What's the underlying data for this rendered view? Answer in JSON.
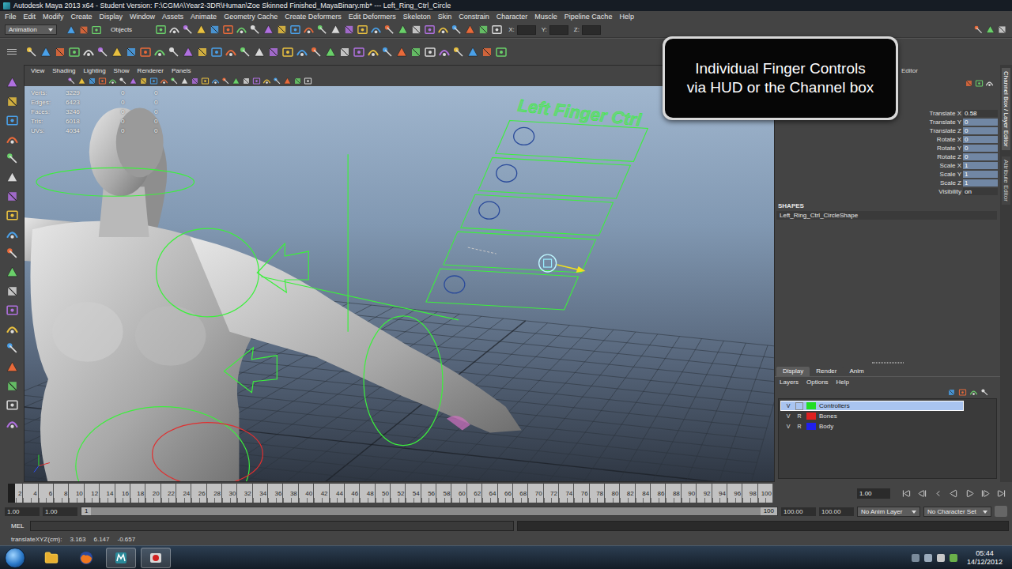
{
  "window": {
    "title": "Autodesk Maya 2013 x64 - Student Version: F:\\CGMA\\Year2-3DR\\Human\\Zoe Skinned Finished_MayaBinary.mb*  ---  Left_Ring_Ctrl_Circle"
  },
  "menu": [
    "File",
    "Edit",
    "Modify",
    "Create",
    "Display",
    "Window",
    "Assets",
    "Animate",
    "Geometry Cache",
    "Create Deformers",
    "Edit Deformers",
    "Skeleton",
    "Skin",
    "Constrain",
    "Character",
    "Muscle",
    "Pipeline Cache",
    "Help"
  ],
  "status_line": {
    "menu_set": "Animation",
    "selection_mask": "Objects",
    "coordinate_fields": [
      "X:",
      "Y:",
      "Z:"
    ]
  },
  "viewport": {
    "menu": [
      "View",
      "Shading",
      "Lighting",
      "Show",
      "Renderer",
      "Panels"
    ],
    "hud": [
      {
        "label": "Verts:",
        "values": [
          "3229",
          "0",
          "0"
        ]
      },
      {
        "label": "Edges:",
        "values": [
          "6423",
          "0",
          "0"
        ]
      },
      {
        "label": "Faces:",
        "values": [
          "3246",
          "0",
          "0"
        ]
      },
      {
        "label": "Tris:",
        "values": [
          "6018",
          "0",
          "0"
        ]
      },
      {
        "label": "UVs:",
        "values": [
          "4034",
          "0",
          "0"
        ]
      }
    ],
    "scene_label": "Left Finger Ctrl",
    "finger_controls": [
      {
        "selected": false
      },
      {
        "selected": false
      },
      {
        "selected": false
      },
      {
        "selected": true
      },
      {
        "selected": false
      }
    ]
  },
  "caption": {
    "lines": [
      "Individual Finger Controls",
      "via HUD or the Channel box"
    ]
  },
  "channel_box": {
    "header": "Editor",
    "channels": [
      {
        "name": "Translate X",
        "value": "0.58",
        "highlighted": false
      },
      {
        "name": "Translate Y",
        "value": "0",
        "highlighted": true
      },
      {
        "name": "Translate Z",
        "value": "0",
        "highlighted": true
      },
      {
        "name": "Rotate X",
        "value": "0",
        "highlighted": true
      },
      {
        "name": "Rotate Y",
        "value": "0",
        "highlighted": true
      },
      {
        "name": "Rotate Z",
        "value": "0",
        "highlighted": true
      },
      {
        "name": "Scale X",
        "value": "1",
        "highlighted": true
      },
      {
        "name": "Scale Y",
        "value": "1",
        "highlighted": true
      },
      {
        "name": "Scale Z",
        "value": "1",
        "highlighted": true
      },
      {
        "name": "Visibility",
        "value": "on",
        "highlighted": false
      }
    ],
    "shapes_title": "SHAPES",
    "shapes": [
      "Left_Ring_Ctrl_CircleShape"
    ]
  },
  "side_tabs": [
    {
      "label": "Channel Box / Layer Editor",
      "selected": true
    },
    {
      "label": "Attribute Editor",
      "selected": false
    }
  ],
  "layer_editor": {
    "tabs": [
      {
        "label": "Display",
        "selected": true
      },
      {
        "label": "Render",
        "selected": false
      },
      {
        "label": "Anim",
        "selected": false
      }
    ],
    "menu": [
      "Layers",
      "Options",
      "Help"
    ],
    "layers": [
      {
        "name": "Controllers",
        "visible": "V",
        "display": "",
        "color": "#22dd22",
        "selected": true
      },
      {
        "name": "Bones",
        "visible": "V",
        "display": "R",
        "color": "#dd2020",
        "selected": false
      },
      {
        "name": "Body",
        "visible": "V",
        "display": "R",
        "color": "#2020ee",
        "selected": false
      }
    ]
  },
  "time_slider": {
    "ticks": [
      "2",
      "4",
      "6",
      "8",
      "10",
      "12",
      "14",
      "16",
      "18",
      "20",
      "22",
      "24",
      "26",
      "28",
      "30",
      "32",
      "34",
      "36",
      "38",
      "40",
      "42",
      "44",
      "46",
      "48",
      "50",
      "52",
      "54",
      "56",
      "58",
      "60",
      "62",
      "64",
      "66",
      "68",
      "70",
      "72",
      "74",
      "76",
      "78",
      "80",
      "82",
      "84",
      "86",
      "88",
      "90",
      "92",
      "94",
      "96",
      "98",
      "100"
    ],
    "current_frame": "1.00",
    "level": 0
  },
  "range_slider": {
    "start": "1.00",
    "range_start": "1.00",
    "handle_start": "1",
    "handle_end": "100",
    "range_end": "100.00",
    "end": "100.00",
    "anim_layer": "No Anim Layer",
    "character_set": "No Character Set"
  },
  "command_line": {
    "language": "MEL"
  },
  "help_line": {
    "label": "translateXYZ(cm):",
    "values": [
      "3.163",
      "6.147",
      "-0.657"
    ]
  },
  "taskbar": {
    "time": "05:44",
    "date": "14/12/2012"
  }
}
